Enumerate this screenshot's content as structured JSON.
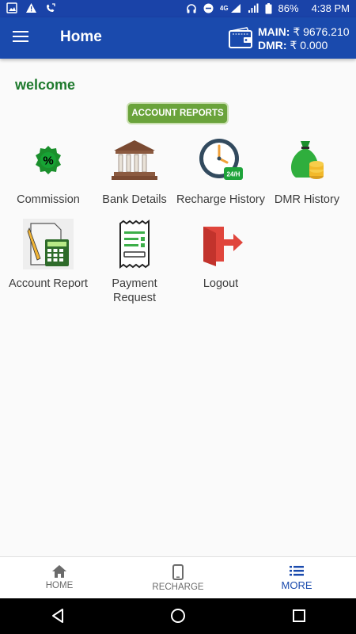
{
  "status_bar": {
    "battery": "86%",
    "time": "4:38 PM",
    "network": "4G"
  },
  "app_bar": {
    "title": "Home",
    "main_label": "MAIN:",
    "main_value": "₹ 9676.210",
    "dmr_label": "DMR:",
    "dmr_value": "₹ 0.000"
  },
  "welcome": "welcome",
  "account_reports_button": "ACCOUNT REPORTS",
  "grid": {
    "commission": "Commission",
    "bank_details": "Bank Details",
    "recharge_history": "Recharge History",
    "dmr_history": "DMR History",
    "account_report": "Account Report",
    "payment_request": "Payment Request",
    "logout": "Logout"
  },
  "clock_badge": "24/H",
  "bottom_nav": {
    "home": "HOME",
    "recharge": "RECHARGE",
    "more": "MORE"
  },
  "colors": {
    "primary": "#1a4aad",
    "welcome_green": "#1e7a2d",
    "button_green": "#6aa33b"
  }
}
